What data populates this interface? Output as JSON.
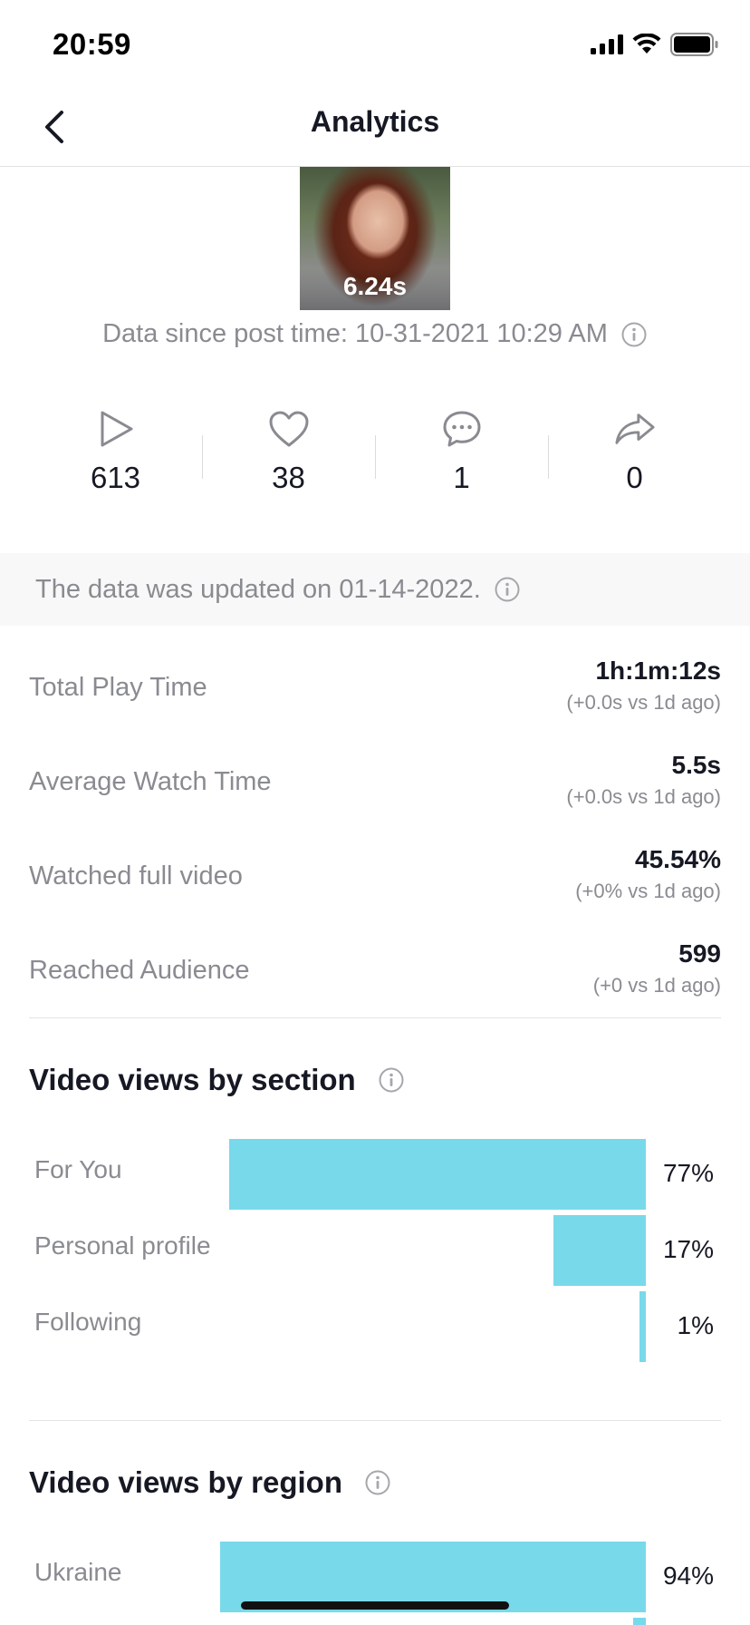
{
  "status_bar": {
    "time": "20:59"
  },
  "nav": {
    "title": "Analytics"
  },
  "video": {
    "duration": "6.24s",
    "post_time": "Data since post time: 10-31-2021 10:29 AM"
  },
  "stats": [
    {
      "icon": "play-icon",
      "value": "613"
    },
    {
      "icon": "heart-icon",
      "value": "38"
    },
    {
      "icon": "comment-icon",
      "value": "1"
    },
    {
      "icon": "share-icon",
      "value": "0"
    }
  ],
  "banner": {
    "text": "The data was updated on 01-14-2022."
  },
  "metrics": [
    {
      "label": "Total Play Time",
      "value": "1h:1m:12s",
      "delta": "(+0.0s vs 1d ago)"
    },
    {
      "label": "Average Watch Time",
      "value": "5.5s",
      "delta": "(+0.0s vs 1d ago)"
    },
    {
      "label": "Watched full video",
      "value": "45.54%",
      "delta": "(+0% vs 1d ago)"
    },
    {
      "label": "Reached Audience",
      "value": "599",
      "delta": "(+0 vs 1d ago)"
    }
  ],
  "views_by_section": {
    "title": "Video views by section",
    "rows": [
      {
        "label": "For You",
        "percent": 77,
        "percent_text": "77%"
      },
      {
        "label": "Personal profile",
        "percent": 17,
        "percent_text": "17%"
      },
      {
        "label": "Following",
        "percent": 1,
        "percent_text": "1%"
      }
    ]
  },
  "views_by_region": {
    "title": "Video views by region",
    "rows": [
      {
        "label": "Ukraine",
        "percent": 94,
        "percent_text": "94%"
      }
    ]
  },
  "colors": {
    "bar": "#78d9ea",
    "text_primary": "#161823",
    "text_secondary": "#8a8b91"
  }
}
